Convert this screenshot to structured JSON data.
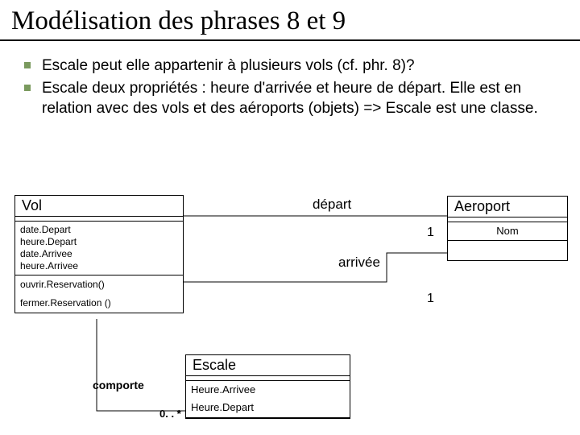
{
  "title": "Modélisation des phrases 8 et 9",
  "bullets": [
    "Escale peut elle appartenir à plusieurs vols (cf. phr. 8)?",
    "Escale deux propriétés : heure d'arrivée et heure de départ. Elle est en relation avec des vols et des aéroports (objets) => Escale est une classe."
  ],
  "classes": {
    "vol": {
      "name": "Vol",
      "attrs": [
        "date.Depart",
        "heure.Depart",
        "date.Arrivee",
        "heure.Arrivee"
      ],
      "ops": [
        "ouvrir.Reservation()",
        "fermer.Reservation ()"
      ]
    },
    "aeroport": {
      "name": "Aeroport",
      "attrs": [
        "Nom"
      ]
    },
    "escale": {
      "name": "Escale",
      "attrs": [
        "Heure.Arrivee",
        "Heure.Depart"
      ]
    }
  },
  "assoc": {
    "depart": "départ",
    "arrivee": "arrivée",
    "comporte": "comporte",
    "mult1a": "1",
    "mult1b": "1",
    "multMany": "0. . *"
  }
}
